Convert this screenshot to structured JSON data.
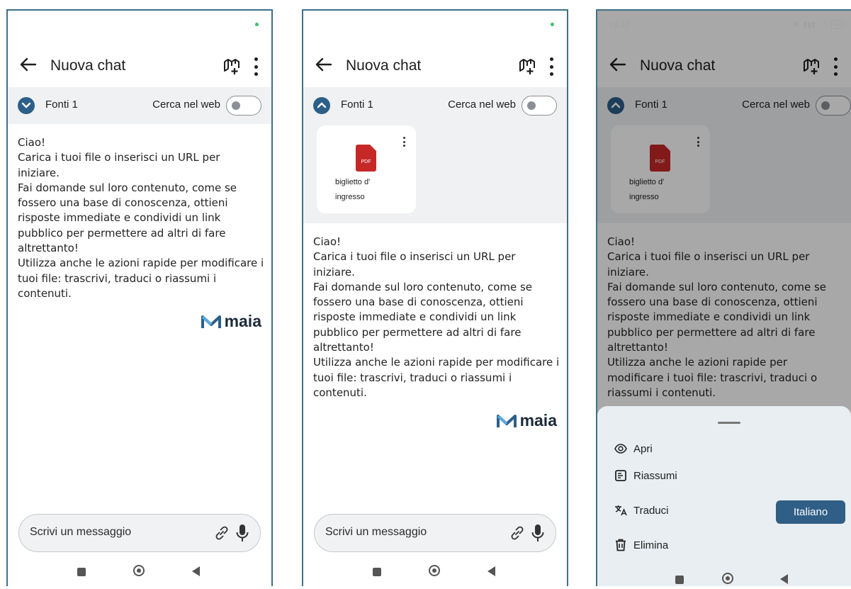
{
  "screens": [
    {
      "header": {
        "title": "Nuova chat"
      },
      "sources_bar": {
        "label": "Fonti 1",
        "web_toggle_label": "Cerca nel web",
        "web_toggle_on": false,
        "expanded": false
      },
      "message": {
        "lines": [
          "Ciao!",
          "Carica i tuoi file o inserisci un URL per iniziare.",
          "Fai domande sul loro contenuto, come se fossero una base di conoscenza, ottieni risposte immediate e condividi un link pubblico per permettere ad altri di fare altrettanto!",
          "Utilizza anche le azioni rapide per modificare i tuoi file: trascrivi, traduci o riassumi i contenuti."
        ]
      },
      "logo": "maia",
      "composer": {
        "placeholder": "Scrivi un messaggio"
      }
    },
    {
      "header": {
        "title": "Nuova chat"
      },
      "sources_bar": {
        "label": "Fonti 1",
        "web_toggle_label": "Cerca nel web",
        "web_toggle_on": false,
        "expanded": true
      },
      "source_card": {
        "icon": "pdf-icon",
        "icon_text": "PDF",
        "name_line1": "biglietto d'",
        "name_line2": "ingresso"
      },
      "message": {
        "lines": [
          "Ciao!",
          "Carica i tuoi file o inserisci un URL per iniziare.",
          "Fai domande sul loro contenuto, come se fossero una base di conoscenza, ottieni risposte immediate e condividi un link pubblico per permettere ad altri di fare altrettanto!",
          "Utilizza anche le azioni rapide per modificare i tuoi file: trascrivi, traduci o riassumi i contenuti."
        ]
      },
      "logo": "maia",
      "composer": {
        "placeholder": "Scrivi un messaggio"
      }
    },
    {
      "status": {
        "time": "15:47",
        "battery": "84"
      },
      "header": {
        "title": "Nuova chat"
      },
      "sources_bar": {
        "label": "Fonti 1",
        "web_toggle_label": "Cerca nel web",
        "web_toggle_on": false,
        "expanded": true
      },
      "source_card": {
        "icon": "pdf-icon",
        "icon_text": "PDF",
        "name_line1": "biglietto d'",
        "name_line2": "ingresso"
      },
      "message": {
        "lines": [
          "Ciao!",
          "Carica i tuoi file o inserisci un URL per iniziare.",
          "Fai domande sul loro contenuto, come se fossero una base di conoscenza, ottieni risposte immediate e condividi un link pubblico per permettere ad altri di fare altrettanto!",
          "Utilizza anche le azioni rapide per modificare i tuoi file: trascrivi, traduci o riassumi i contenuti."
        ]
      },
      "sheet": {
        "options": [
          {
            "label": "Apri",
            "icon": "eye-icon"
          },
          {
            "label": "Riassumi",
            "icon": "summary-icon"
          },
          {
            "label": "Traduci",
            "icon": "translate-icon"
          },
          {
            "label": "Elimina",
            "icon": "trash-icon"
          }
        ],
        "language_button": "Italiano"
      }
    }
  ],
  "colors": {
    "accent": "#2c5f8a",
    "frame": "#3f6f8a",
    "source_bg": "#f0f1f3",
    "sheet_bg": "#e9eef2",
    "pdf_red": "#c62828"
  }
}
